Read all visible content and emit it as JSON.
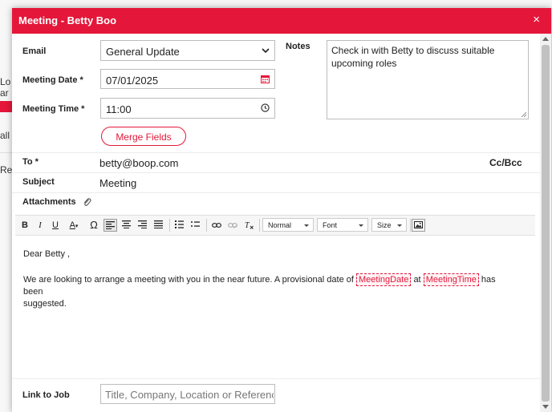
{
  "background": {
    "fragments": [
      "Lo",
      "ar",
      "all",
      "Ret"
    ]
  },
  "modal": {
    "title": "Meeting - Betty Boo",
    "close_symbol": "×",
    "email": {
      "label": "Email",
      "selected": "General Update"
    },
    "meeting_date": {
      "label": "Meeting Date *",
      "value": "07/01/2025"
    },
    "meeting_time": {
      "label": "Meeting Time *",
      "value": "11:00"
    },
    "merge_fields_label": "Merge Fields",
    "notes": {
      "label": "Notes",
      "value": "Check in with Betty to discuss suitable upcoming roles"
    },
    "to": {
      "label": "To *",
      "value": "betty@boop.com",
      "cc_bcc_label": "Cc/Bcc"
    },
    "subject": {
      "label": "Subject",
      "value": "Meeting"
    },
    "attachments_label": "Attachments",
    "toolbar": {
      "bold": "B",
      "italic": "I",
      "underline": "U",
      "font_color": "A",
      "special_char": "Ω",
      "format_value": "Normal",
      "font_value": "Font",
      "size_value": "Size"
    },
    "editor": {
      "greeting": "Dear Betty ,",
      "line_before": "We are looking to arrange a meeting with you in the near future. A provisional date of",
      "placeholder_date": "MeetingDate",
      "at_word": "at",
      "placeholder_time": "MeetingTime",
      "line_after": "has been",
      "line_end": "suggested."
    },
    "link_to_job": {
      "label": "Link to Job",
      "placeholder": "Title, Company, Location or Reference"
    }
  },
  "colors": {
    "accent": "#e4173a"
  }
}
